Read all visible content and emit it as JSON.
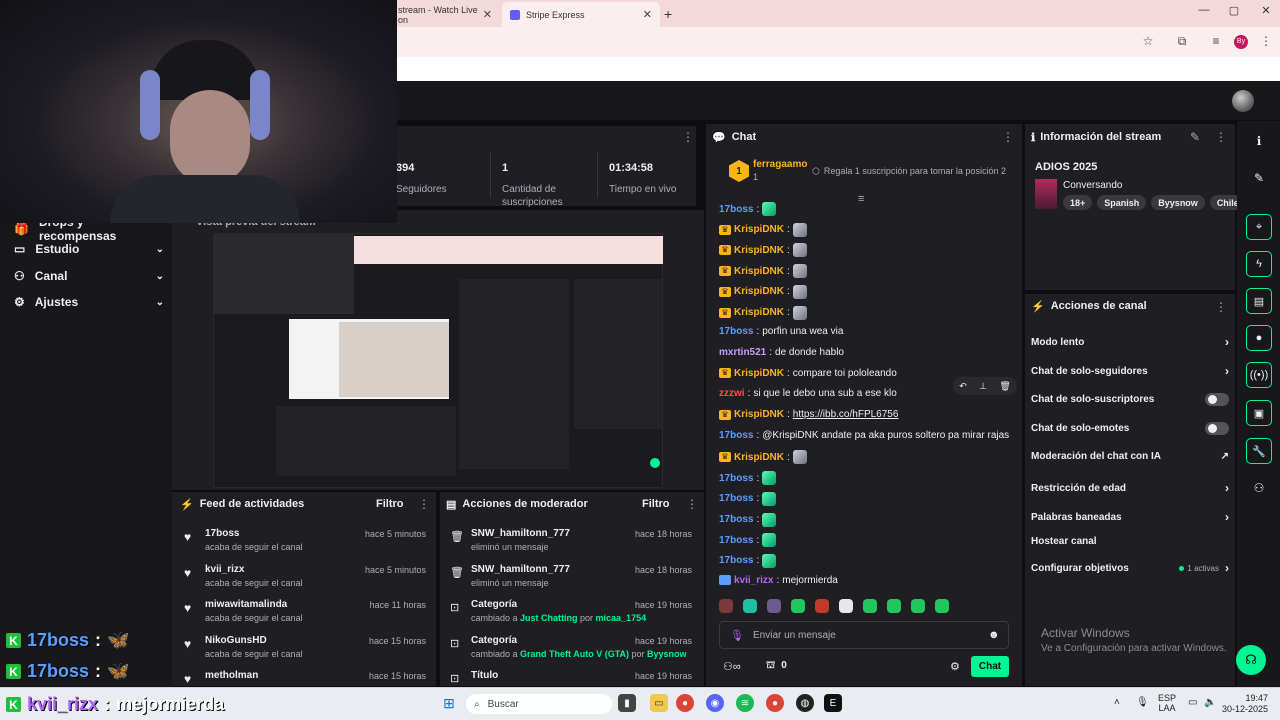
{
  "browser": {
    "tabs": [
      {
        "label": "stream - Watch Live on",
        "active": false
      },
      {
        "label": "Stripe Express",
        "active": true
      }
    ],
    "new_tab": "+"
  },
  "stats": [
    {
      "value": "394",
      "label": "Seguidores"
    },
    {
      "value": "1",
      "label": "Cantidad de suscripciones"
    },
    {
      "value": "01:34:58",
      "label": "Tiempo en vivo"
    }
  ],
  "leftnav": {
    "items": [
      {
        "label": "Drops y recompensas"
      },
      {
        "label": "Estudio"
      },
      {
        "label": "Canal"
      },
      {
        "label": "Ajustes"
      }
    ]
  },
  "preview": {
    "title": "Vista previa del stream"
  },
  "activity_feed": {
    "title": "Feed de actividades",
    "filter": "Filtro",
    "items": [
      {
        "name": "17boss",
        "sub": "acaba de seguir el canal",
        "time": "hace 5 minutos"
      },
      {
        "name": "kvii_rizx",
        "sub": "acaba de seguir el canal",
        "time": "hace 5 minutos"
      },
      {
        "name": "miwawitamalinda",
        "sub": "acaba de seguir el canal",
        "time": "hace 11 horas"
      },
      {
        "name": "NikoGunsHD",
        "sub": "acaba de seguir el canal",
        "time": "hace 15 horas"
      },
      {
        "name": "metholman",
        "sub": "",
        "time": "hace 15 horas"
      }
    ]
  },
  "mod_actions": {
    "title": "Acciones de moderador",
    "filter": "Filtro",
    "items": [
      {
        "name": "SNW_hamiltonn_777",
        "sub": "eliminó un mensaje",
        "time": "hace 18 horas"
      },
      {
        "name": "SNW_hamiltonn_777",
        "sub": "eliminó un mensaje",
        "time": "hace 18 horas"
      },
      {
        "name": "Categoría",
        "sub_pre": "cambiado a ",
        "sub_hl": "Just Chatting",
        "sub_mid": " por ",
        "sub_user": "micaa_1754",
        "time": "hace 19 horas"
      },
      {
        "name": "Categoría",
        "sub_pre": "cambiado a ",
        "sub_hl": "Grand Theft Auto V (GTA)",
        "sub_mid": " por ",
        "sub_user": "Byysnow",
        "time": "hace 19 horas"
      },
      {
        "name": "Título",
        "sub": "",
        "time": "hace 19 horas"
      }
    ]
  },
  "chat": {
    "title": "Chat",
    "pinned": {
      "rank": "1",
      "user": "ferragaamo",
      "count": "1",
      "text": "Regala 1 suscripción para tomar la posición 2"
    },
    "messages": [
      {
        "user": "17boss",
        "cls": "u-17",
        "text": "",
        "emote": "green"
      },
      {
        "user": "KrispiDNK",
        "cls": "u-krispi",
        "crown": true,
        "text": "",
        "emote": "drink"
      },
      {
        "user": "KrispiDNK",
        "cls": "u-krispi",
        "crown": true,
        "text": "",
        "emote": "drink"
      },
      {
        "user": "KrispiDNK",
        "cls": "u-krispi",
        "crown": true,
        "text": "",
        "emote": "drink"
      },
      {
        "user": "KrispiDNK",
        "cls": "u-krispi",
        "crown": true,
        "text": "",
        "emote": "drink"
      },
      {
        "user": "KrispiDNK",
        "cls": "u-krispi",
        "crown": true,
        "text": "",
        "emote": "drink"
      },
      {
        "user": "17boss",
        "cls": "u-17",
        "text": "porfin una wea via"
      },
      {
        "user": "mxrtin521",
        "cls": "u-mx",
        "text": "de donde hablo"
      },
      {
        "user": "KrispiDNK",
        "cls": "u-krispi",
        "crown": true,
        "text": "compare toi pololeando"
      },
      {
        "user": "zzzwi",
        "cls": "u-zz",
        "text": "si que le debo una sub a ese klo"
      },
      {
        "user": "KrispiDNK",
        "cls": "u-krispi",
        "crown": true,
        "text": "https://ibb.co/hFPL6756",
        "link": true
      },
      {
        "user": "17boss",
        "cls": "u-17",
        "text": "@KrispiDNK andate pa aka puros soltero pa mirar rajas"
      },
      {
        "user": "KrispiDNK",
        "cls": "u-krispi",
        "crown": true,
        "text": "",
        "emote": "drink"
      },
      {
        "user": "17boss",
        "cls": "u-17",
        "text": "",
        "emote": "green"
      },
      {
        "user": "17boss",
        "cls": "u-17",
        "text": "",
        "emote": "green"
      },
      {
        "user": "17boss",
        "cls": "u-17",
        "text": "",
        "emote": "green"
      },
      {
        "user": "17boss",
        "cls": "u-17",
        "text": "",
        "emote": "green"
      },
      {
        "user": "17boss",
        "cls": "u-17",
        "text": "",
        "emote": "green"
      },
      {
        "user": "kvii_rizx",
        "cls": "u-kv",
        "text": "mejormierda",
        "badge": true
      }
    ],
    "input_placeholder": "Enviar un mensaje",
    "points": "0",
    "send": "Chat"
  },
  "stream_info": {
    "title": "Información del stream",
    "stream_title": "ADIOS 2025",
    "category": "Conversando",
    "tags": [
      "18+",
      "Spanish",
      "Byysnow",
      "Chile"
    ]
  },
  "channel_actions": {
    "title": "Acciones de canal",
    "items": [
      {
        "label": "Modo lento",
        "control": "chevron"
      },
      {
        "label": "Chat de solo-seguidores",
        "control": "chevron"
      },
      {
        "label": "Chat de solo-suscriptores",
        "control": "toggle"
      },
      {
        "label": "Chat de solo-emotes",
        "control": "toggle"
      },
      {
        "label": "Moderación del chat con IA",
        "control": "external"
      },
      {
        "label": "Restricción de edad",
        "control": "chevron"
      },
      {
        "label": "Palabras baneadas",
        "control": "chevron"
      },
      {
        "label": "Hostear canal",
        "control": "none"
      },
      {
        "label": "Configurar objetivos",
        "control": "chevron",
        "extra": "1 activas"
      }
    ]
  },
  "watermark": {
    "line1": "Activar Windows",
    "line2": "Ve a Configuración para activar Windows."
  },
  "overlay": [
    {
      "user": "17boss",
      "sep": ":"
    },
    {
      "user": "17boss",
      "sep": ":"
    },
    {
      "user": "kvii_rizx",
      "sep": ":",
      "text": "mejormierda"
    }
  ],
  "taskbar": {
    "search": "Buscar",
    "lang1": "ESP",
    "lang2": "LAA",
    "time": "19:47",
    "date": "30-12-2025"
  }
}
